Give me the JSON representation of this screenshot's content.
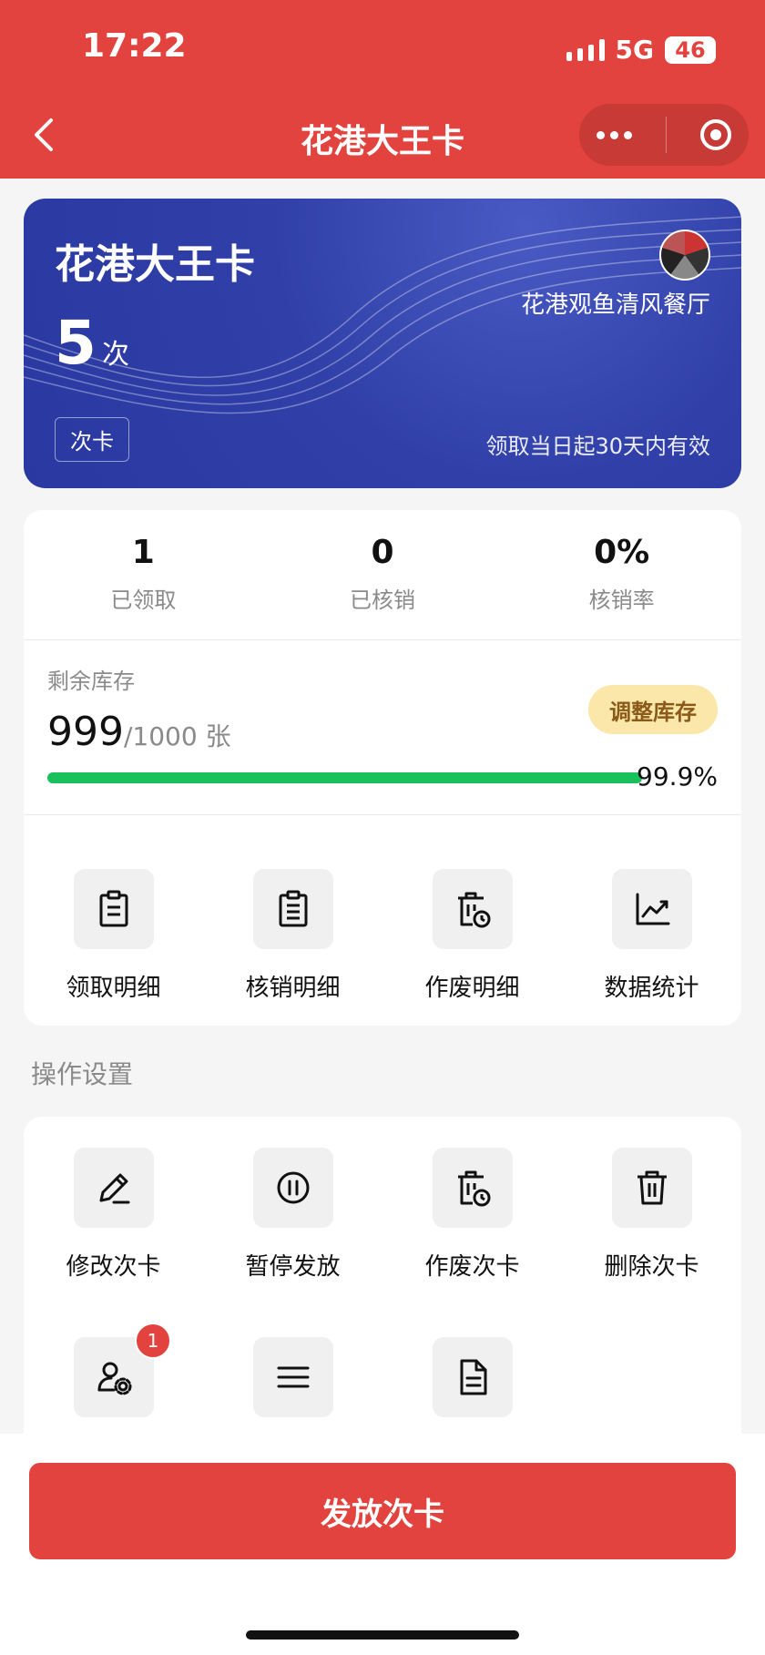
{
  "status": {
    "time": "17:22",
    "network": "5G",
    "battery": "46"
  },
  "nav": {
    "title": "花港大王卡"
  },
  "card": {
    "title": "花港大王卡",
    "count": "5",
    "count_unit": "次",
    "tag": "次卡",
    "shop_name": "花港观鱼清风餐厅",
    "validity": "领取当日起30天内有效"
  },
  "stats": [
    {
      "value": "1",
      "label": "已领取"
    },
    {
      "value": "0",
      "label": "已核销"
    },
    {
      "value": "0%",
      "label": "核销率"
    }
  ],
  "stock": {
    "label": "剩余库存",
    "current": "999",
    "total": "/1000 张",
    "adjust_label": "调整库存",
    "percent_text": "99.9%",
    "fill_fraction": 0.999
  },
  "detail_items": [
    {
      "label": "领取明细",
      "icon": "clipboard-icon"
    },
    {
      "label": "核销明细",
      "icon": "clipboard-list-icon"
    },
    {
      "label": "作废明细",
      "icon": "trash-clock-icon"
    },
    {
      "label": "数据统计",
      "icon": "chart-line-icon"
    }
  ],
  "ops_title": "操作设置",
  "ops_items": [
    {
      "label": "修改次卡",
      "icon": "edit-icon"
    },
    {
      "label": "暂停发放",
      "icon": "pause-icon"
    },
    {
      "label": "作废次卡",
      "icon": "trash-clock-icon"
    },
    {
      "label": "删除次卡",
      "icon": "trash-icon"
    },
    {
      "label": "",
      "icon": "user-settings-icon",
      "badge": "1"
    },
    {
      "label": "",
      "icon": "menu-icon"
    },
    {
      "label": "",
      "icon": "document-icon"
    }
  ],
  "issue_button": "发放次卡",
  "colors": {
    "primary": "#e3433e",
    "card": "#2f3fa7",
    "progress": "#18c15b"
  }
}
